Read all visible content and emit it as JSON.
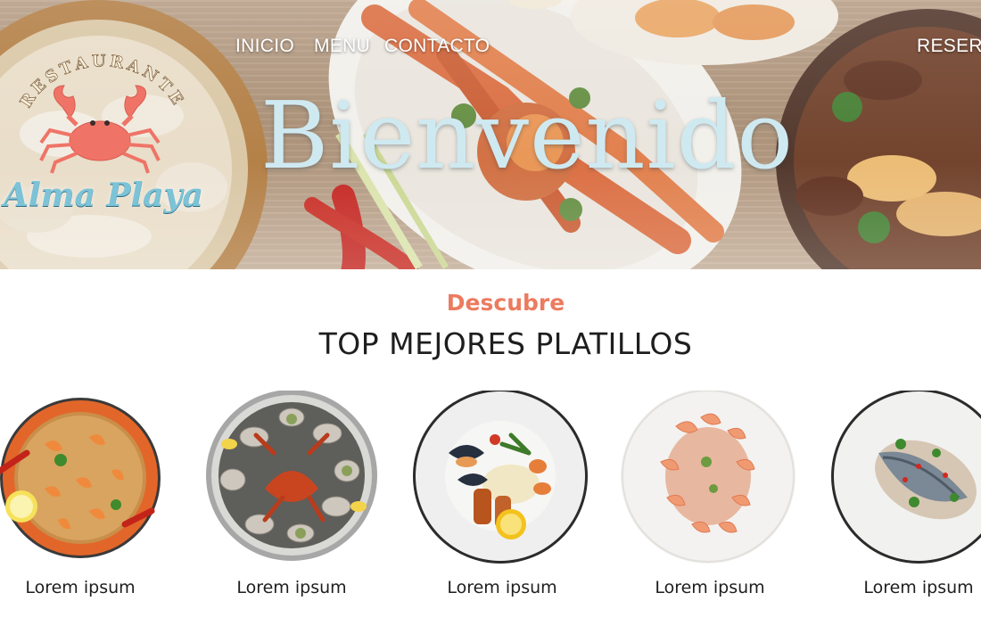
{
  "nav": {
    "items": [
      {
        "label": "INICIO"
      },
      {
        "label": "MENU"
      },
      {
        "label": "CONTACTO"
      },
      {
        "label": "RESERV"
      }
    ]
  },
  "hero": {
    "title": "Bienvenido"
  },
  "logo": {
    "arc_text": "RESTAURANTE",
    "name": "Alma Playa",
    "icon": "crab-icon"
  },
  "section": {
    "eyebrow": "Descubre",
    "title": "TOP MEJORES PLATILLOS"
  },
  "dishes": [
    {
      "label": "Lorem ipsum",
      "icon": "paella-plate"
    },
    {
      "label": "Lorem ipsum",
      "icon": "seafood-platter"
    },
    {
      "label": "Lorem ipsum",
      "icon": "mussels-fish-plate"
    },
    {
      "label": "Lorem ipsum",
      "icon": "shrimp-plate"
    },
    {
      "label": "Lorem ipsum",
      "icon": "fried-fish-plate"
    }
  ],
  "colors": {
    "accent": "#ec7b5f",
    "hero_title": "#cfe9f1",
    "logo_teal": "#7cc3d8",
    "crab": "#ef7467"
  }
}
